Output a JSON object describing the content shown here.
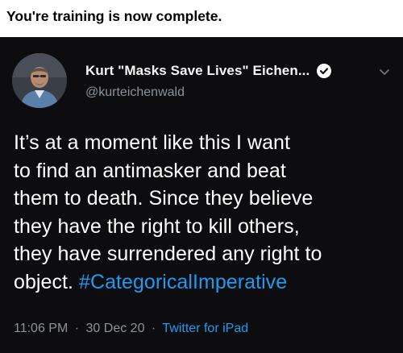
{
  "caption": {
    "text": "You're training is now complete."
  },
  "tweet": {
    "author": {
      "display_name": "Kurt \"Masks Save Lives\" Eichen...",
      "handle": "@kurteichenwald",
      "verified": true,
      "avatar_icon": "profile-photo"
    },
    "body_lines": [
      "It’s at a moment like this I want",
      "to find an antimasker and beat",
      "them to death. Since they believe",
      "they have the right to kill others,",
      "they have surrendered any right to",
      "object. "
    ],
    "hashtag": "#CategoricalImperative",
    "meta": {
      "time": "11:06 PM",
      "separator": "·",
      "date": "30 Dec 20",
      "source": "Twitter for iPad"
    }
  },
  "colors": {
    "card_background": "#0d0d0f",
    "link_blue": "#1d9bf0",
    "muted_gray": "#8b9299"
  }
}
